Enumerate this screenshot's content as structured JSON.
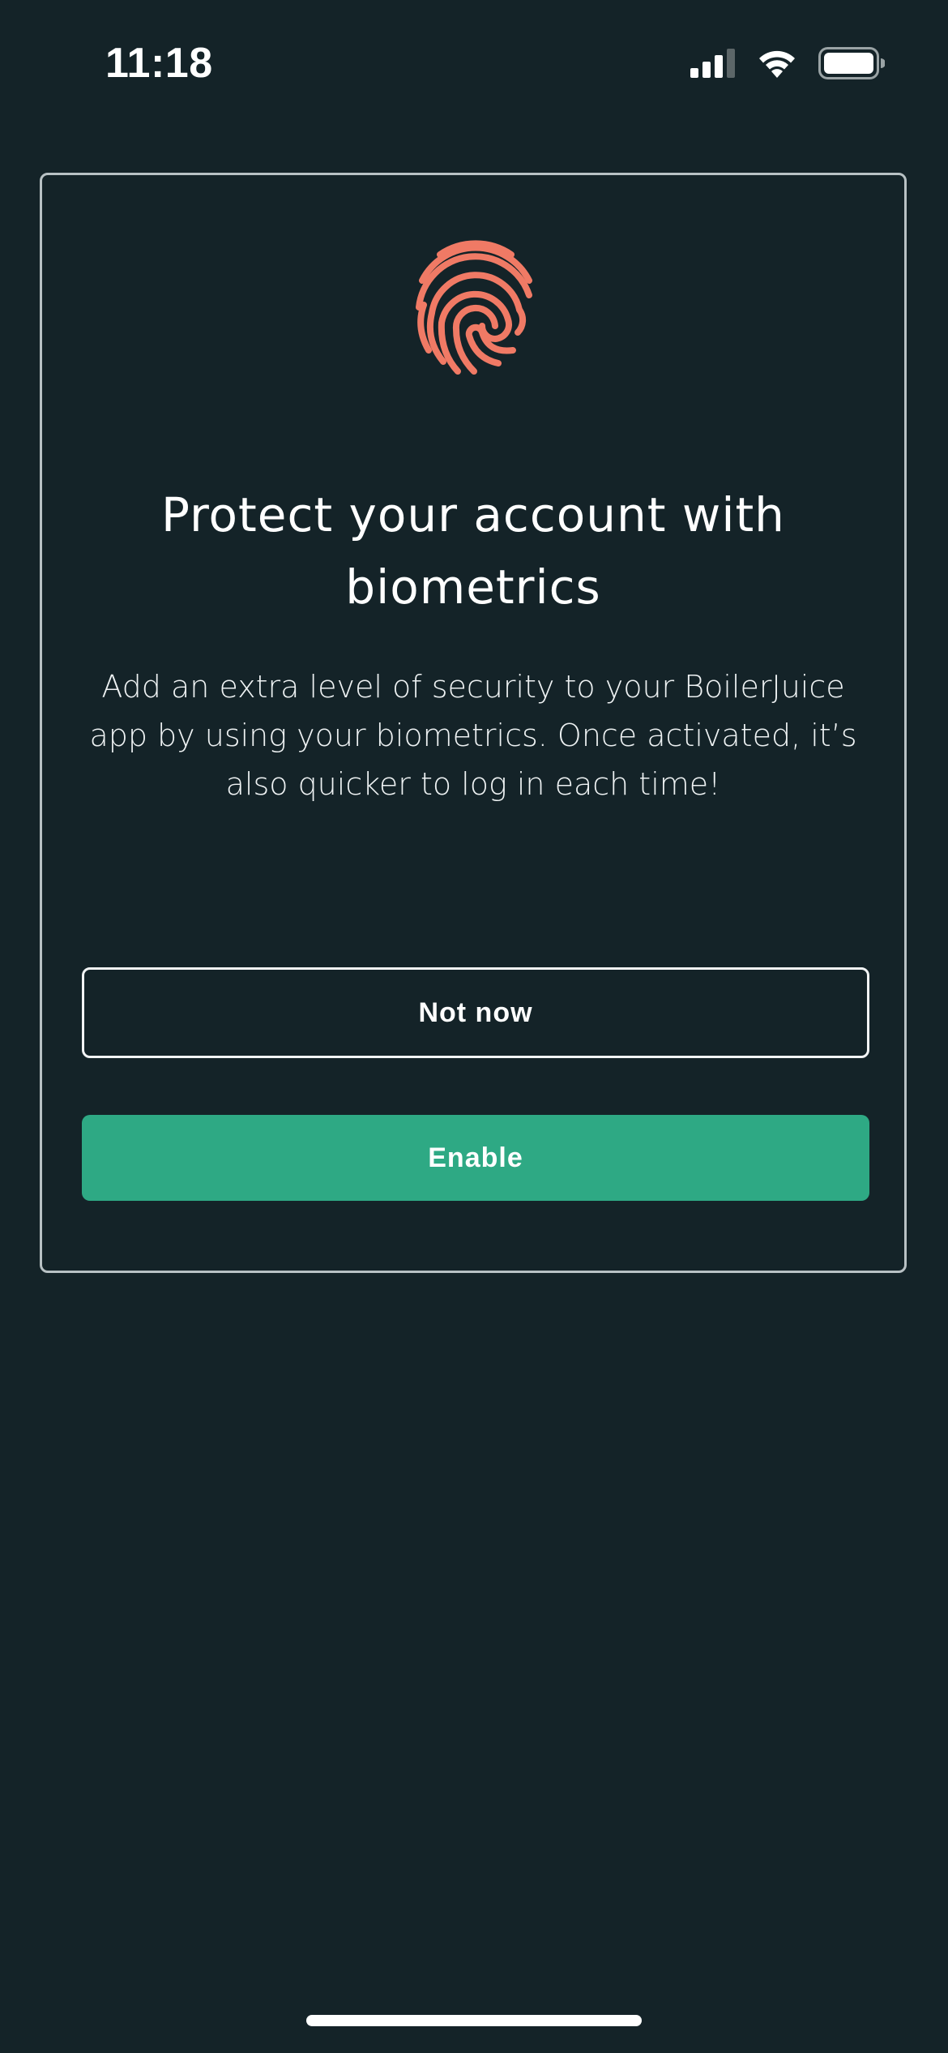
{
  "status_bar": {
    "time": "11:18",
    "icons": [
      "cellular-signal-icon",
      "wifi-icon",
      "battery-icon"
    ]
  },
  "card": {
    "icon": "fingerprint-icon",
    "title": "Protect your account with biometrics",
    "description": "Add an extra level of security to your BoilerJuice app by using your biometrics. Once activated, it’s also quicker to log in each time!",
    "buttons": {
      "not_now_label": "Not now",
      "enable_label": "Enable"
    }
  },
  "colors": {
    "background": "#142328",
    "accent": "#2ea984",
    "fingerprint": "#f07a65",
    "card_border": "#b8c1c4"
  }
}
